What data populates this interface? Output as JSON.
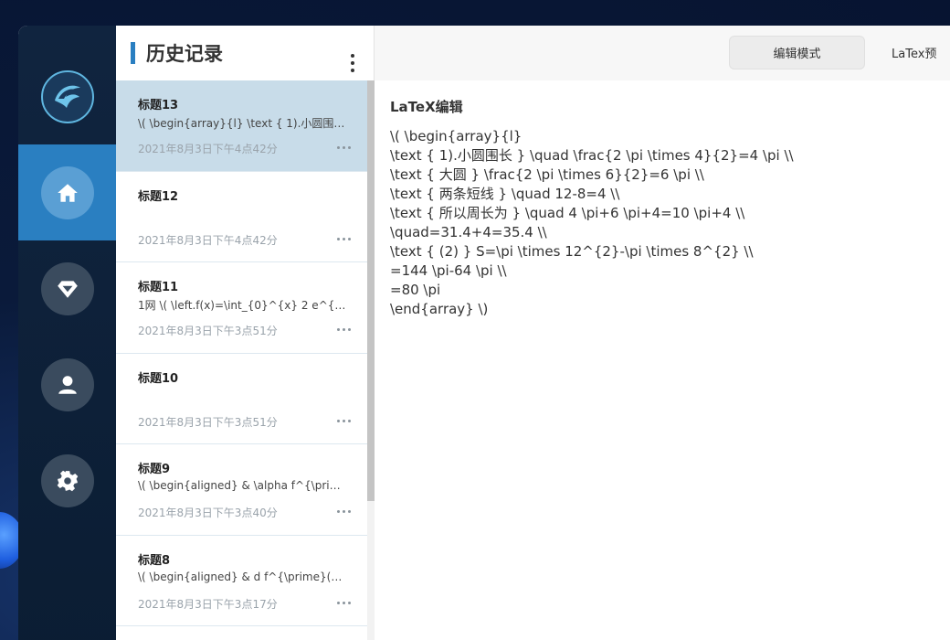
{
  "history": {
    "title": "历史记录",
    "items": [
      {
        "title": "标题13",
        "preview": "\\( \\begin{array}{l} \\text { 1).小圆围长 }...",
        "date": "2021年8月3日下午4点42分"
      },
      {
        "title": "标题12",
        "preview": "",
        "date": "2021年8月3日下午4点42分"
      },
      {
        "title": "标题11",
        "preview": "1网 \\( \\left.f(x)=\\int_{0}^{x} 2 e^{-\\fra...",
        "date": "2021年8月3日下午3点51分"
      },
      {
        "title": "标题10",
        "preview": "",
        "date": "2021年8月3日下午3点51分"
      },
      {
        "title": "标题9",
        "preview": "\\( \\begin{aligned} & \\alpha f^{\\prim...",
        "date": "2021年8月3日下午3点40分"
      },
      {
        "title": "标题8",
        "preview": "\\( \\begin{aligned} & d f^{\\prime}(x)=...",
        "date": "2021年8月3日下午3点17分"
      }
    ]
  },
  "editor": {
    "tabs": {
      "edit_mode": "编辑模式",
      "preview": "LaTex预"
    },
    "section_title": "LaTeX编辑",
    "lines": [
      "\\( \\begin{array}{l}",
      "\\text { 1).小圆围长 } \\quad \\frac{2 \\pi \\times 4}{2}=4 \\pi \\\\",
      "\\text { 大圆 } \\frac{2 \\pi \\times 6}{2}=6 \\pi \\\\",
      "\\text { 两条短线 } \\quad 12-8=4 \\\\",
      "\\text { 所以周长为 } \\quad 4 \\pi+6 \\pi+4=10 \\pi+4 \\\\",
      "\\quad=31.4+4=35.4 \\\\",
      "\\text { (2) } S=\\pi \\times 12^{2}-\\pi \\times 8^{2} \\\\",
      "=144 \\pi-64 \\pi \\\\",
      "=80 \\pi",
      "\\end{array} \\)"
    ]
  },
  "colors": {
    "accent": "#2a7fc1",
    "selected_row": "#c8dce9",
    "rail": "#0b1d33"
  },
  "icons": {
    "logo": "eagle-logo-icon",
    "nav": [
      "home-icon",
      "diamond-icon",
      "user-icon",
      "gear-icon"
    ]
  }
}
